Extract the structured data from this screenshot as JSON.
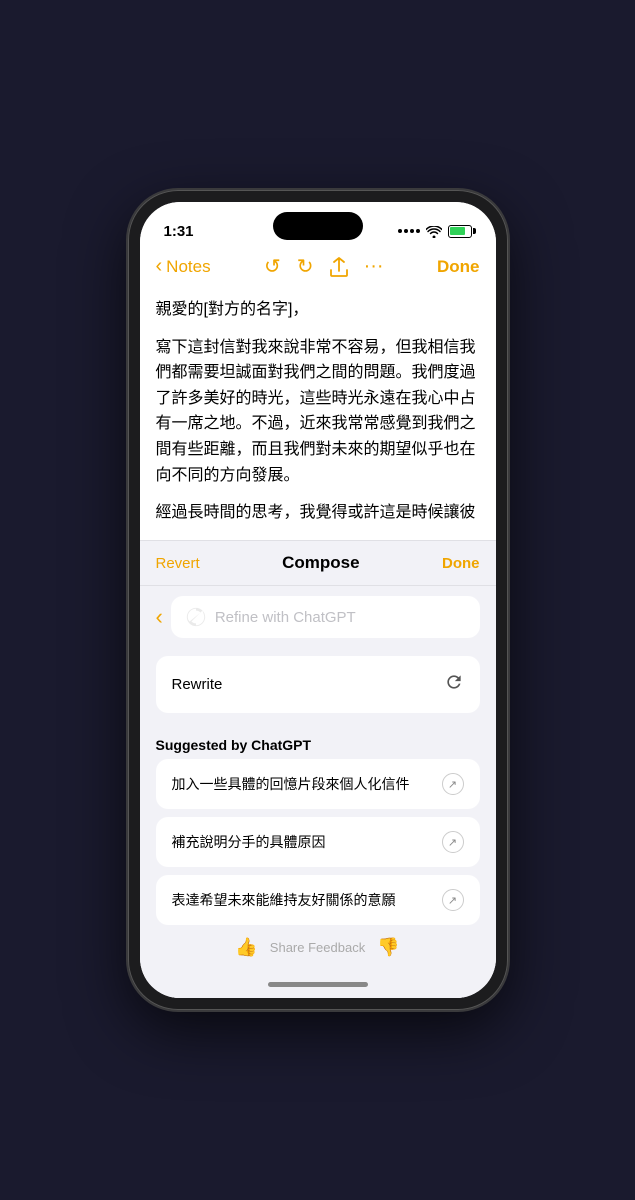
{
  "status_bar": {
    "time": "1:31",
    "wifi": "wifi",
    "battery": "battery"
  },
  "nav": {
    "back_label": "Notes",
    "done_label": "Done"
  },
  "note": {
    "line1": "親愛的[對方的名字]，",
    "paragraph1": "寫下這封信對我來說非常不容易，但我相信我們都需要坦誠面對我們之間的問題。我們度過了許多美好的時光，這些時光永遠在我心中占有一席之地。不過，近來我常常感覺到我們之間有些距離，而且我們對未來的期望似乎也在向不同的方向發展。",
    "paragraph2": "經過長時間的思考，我覺得或許這是時候讓彼"
  },
  "compose": {
    "revert_label": "Revert",
    "title": "Compose",
    "done_label": "Done",
    "search_placeholder": "Refine with ChatGPT"
  },
  "rewrite": {
    "label": "Rewrite"
  },
  "suggested": {
    "header": "Suggested by ChatGPT",
    "items": [
      "加入一些具體的回憶片段來個人化信件",
      "補充說明分手的具體原因",
      "表達希望未來能維持友好關係的意願"
    ]
  },
  "feedback": {
    "label": "Share Feedback"
  }
}
